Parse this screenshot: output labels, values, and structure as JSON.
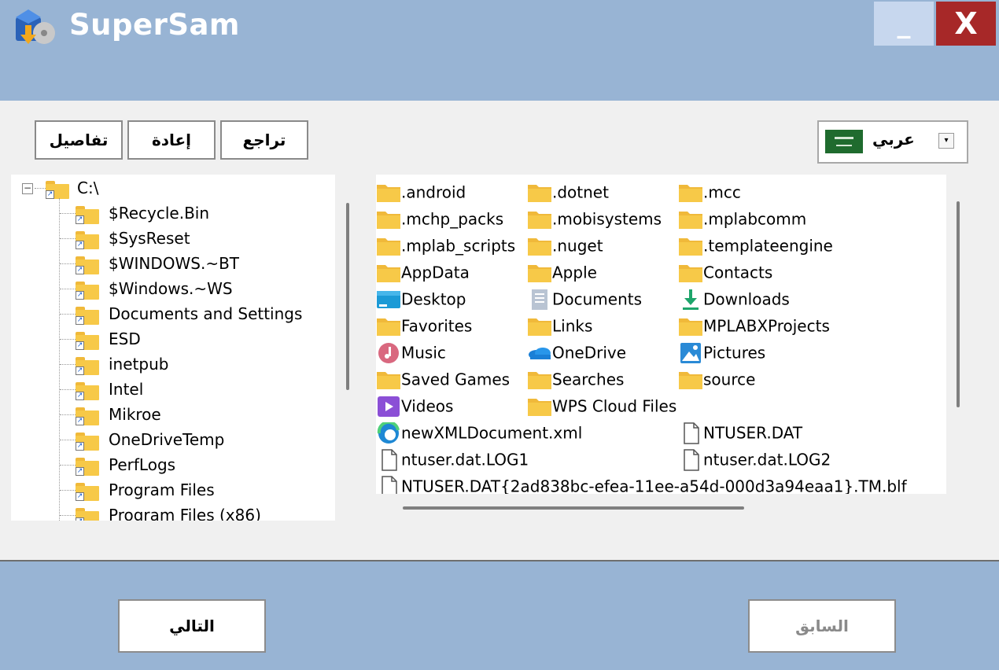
{
  "window": {
    "title": "SuperSam",
    "minimize_label": "_",
    "close_label": "X"
  },
  "toolbar": {
    "details_label": "تفاصيل",
    "redo_label": "إعادة",
    "undo_label": "تراجع"
  },
  "language": {
    "selected": "عربي",
    "flag_icon": "saudi-flag-icon"
  },
  "tree": {
    "root": "C:\\",
    "items": [
      "$Recycle.Bin",
      "$SysReset",
      "$WINDOWS.~BT",
      "$Windows.~WS",
      "Documents and Settings",
      "ESD",
      "inetpub",
      "Intel",
      "Mikroe",
      "OneDriveTemp",
      "PerfLogs",
      "Program Files",
      "Program Files (x86)"
    ]
  },
  "files": [
    {
      "name": ".android",
      "icon": "folder-icon"
    },
    {
      "name": ".dotnet",
      "icon": "folder-icon"
    },
    {
      "name": ".mcc",
      "icon": "folder-icon"
    },
    {
      "name": ".mchp_packs",
      "icon": "folder-icon"
    },
    {
      "name": ".mobisystems",
      "icon": "folder-icon"
    },
    {
      "name": ".mplabcomm",
      "icon": "folder-icon"
    },
    {
      "name": ".mplab_scripts",
      "icon": "folder-icon"
    },
    {
      "name": ".nuget",
      "icon": "folder-icon"
    },
    {
      "name": ".templateengine",
      "icon": "folder-icon"
    },
    {
      "name": "AppData",
      "icon": "folder-icon"
    },
    {
      "name": "Apple",
      "icon": "folder-icon"
    },
    {
      "name": "Contacts",
      "icon": "folder-icon"
    },
    {
      "name": "Desktop",
      "icon": "desktop-icon"
    },
    {
      "name": "Documents",
      "icon": "documents-icon"
    },
    {
      "name": "Downloads",
      "icon": "downloads-icon"
    },
    {
      "name": "Favorites",
      "icon": "folder-icon"
    },
    {
      "name": "Links",
      "icon": "folder-icon"
    },
    {
      "name": "MPLABXProjects",
      "icon": "folder-icon"
    },
    {
      "name": "Music",
      "icon": "music-icon"
    },
    {
      "name": "OneDrive",
      "icon": "onedrive-icon"
    },
    {
      "name": "Pictures",
      "icon": "pictures-icon"
    },
    {
      "name": "Saved Games",
      "icon": "folder-icon"
    },
    {
      "name": "Searches",
      "icon": "folder-icon"
    },
    {
      "name": "source",
      "icon": "folder-icon"
    },
    {
      "name": "Videos",
      "icon": "videos-icon"
    },
    {
      "name": "WPS Cloud Files",
      "icon": "folder-icon"
    },
    {
      "name": "newXMLDocument.xml",
      "icon": "edge-icon"
    },
    {
      "name": "NTUSER.DAT",
      "icon": "file-icon"
    },
    {
      "name": "ntuser.dat.LOG1",
      "icon": "file-icon"
    },
    {
      "name": "ntuser.dat.LOG2",
      "icon": "file-icon"
    },
    {
      "name": "NTUSER.DAT{2ad838bc-efea-11ee-a54d-000d3a94eaa1}.TM.blf",
      "icon": "file-icon"
    }
  ],
  "footer": {
    "next_label": "التالي",
    "previous_label": "السابق"
  },
  "colors": {
    "titlebar": "#98b4d4",
    "close_button": "#a72828",
    "minimize_button": "#c7d7ee",
    "folder": "#f7c948"
  }
}
